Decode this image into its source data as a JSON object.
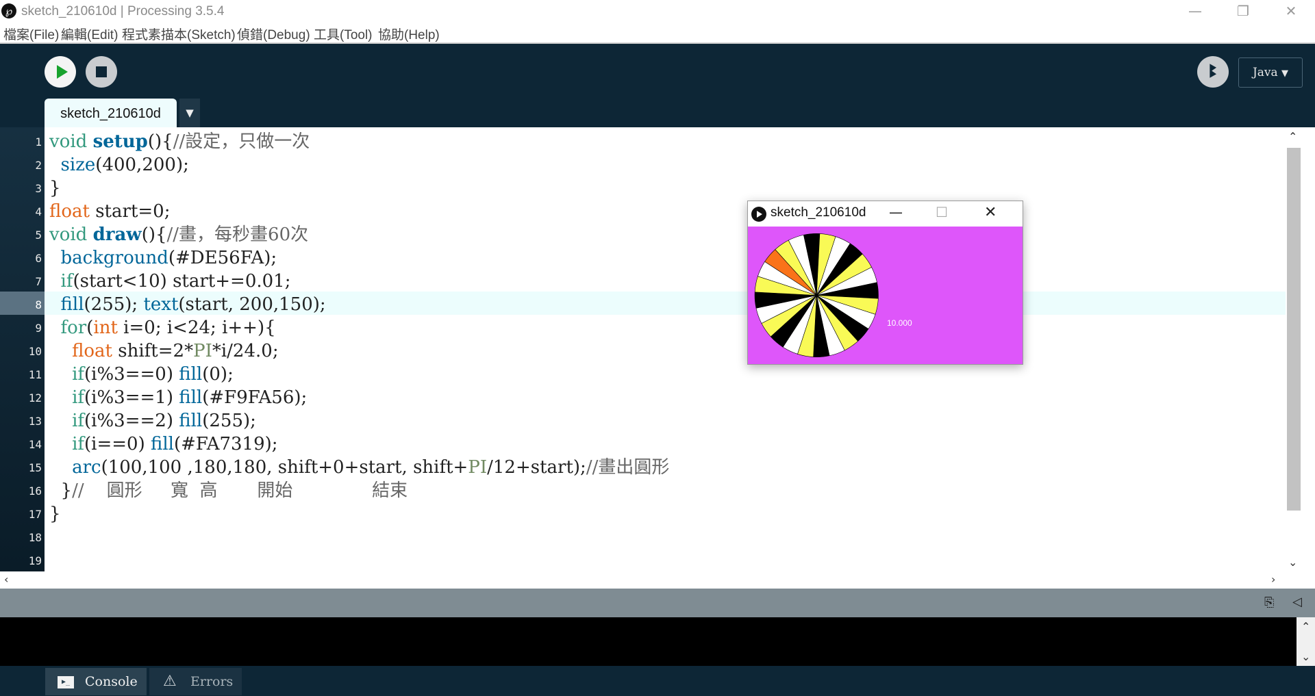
{
  "window": {
    "app_icon": "processing-p-icon",
    "title": "sketch_210610d | Processing 3.5.4",
    "controls": {
      "minimize": "—",
      "restore": "❐",
      "close": "✕"
    }
  },
  "menu": [
    "檔案(File)",
    "編輯(Edit)",
    "程式素描本(Sketch)",
    "偵錯(Debug)",
    "工具(Tool)",
    "協助(Help)"
  ],
  "toolbar": {
    "run_icon": "play-icon",
    "stop_icon": "stop-icon",
    "debug_icon": "butterfly-icon",
    "debug_glyph": "ꔪ",
    "mode": "Java",
    "mode_arrow": "▼"
  },
  "tabs": {
    "active": "sketch_210610d",
    "menu_arrow": "▼"
  },
  "editor": {
    "current_line": 8,
    "line_numbers": [
      "1",
      "2",
      "3",
      "4",
      "5",
      "6",
      "7",
      "8",
      "9",
      "10",
      "11",
      "12",
      "13",
      "14",
      "15",
      "16",
      "17",
      "18",
      "19"
    ],
    "lines": [
      [
        {
          "t": "void",
          "c": "k"
        },
        {
          "t": " "
        },
        {
          "t": "setup",
          "c": "fb"
        },
        {
          "t": "(){"
        },
        {
          "t": "//設定，只做一次",
          "c": "c"
        }
      ],
      [
        {
          "t": "  "
        },
        {
          "t": "size",
          "c": "f"
        },
        {
          "t": "(400,200);"
        }
      ],
      [
        {
          "t": "}"
        }
      ],
      [
        {
          "t": "float",
          "c": "t"
        },
        {
          "t": " start=0;"
        }
      ],
      [
        {
          "t": "void",
          "c": "k"
        },
        {
          "t": " "
        },
        {
          "t": "draw",
          "c": "fb"
        },
        {
          "t": "(){"
        },
        {
          "t": "//畫，每秒畫60次",
          "c": "c"
        }
      ],
      [
        {
          "t": "  "
        },
        {
          "t": "background",
          "c": "f"
        },
        {
          "t": "(#DE56FA);"
        }
      ],
      [
        {
          "t": "  "
        },
        {
          "t": "if",
          "c": "k"
        },
        {
          "t": "(start<10) start+=0.01;"
        }
      ],
      [
        {
          "t": "  "
        },
        {
          "t": "fill",
          "c": "f"
        },
        {
          "t": "(255); "
        },
        {
          "t": "text",
          "c": "f"
        },
        {
          "t": "(start, 200,150);"
        }
      ],
      [
        {
          "t": "  "
        },
        {
          "t": "for",
          "c": "k"
        },
        {
          "t": "("
        },
        {
          "t": "int",
          "c": "t"
        },
        {
          "t": " i=0; i<24; i++){"
        }
      ],
      [
        {
          "t": "    "
        },
        {
          "t": "float",
          "c": "t"
        },
        {
          "t": " shift=2*"
        },
        {
          "t": "PI",
          "c": "cn"
        },
        {
          "t": "*i/24.0;"
        }
      ],
      [
        {
          "t": "    "
        },
        {
          "t": "if",
          "c": "k"
        },
        {
          "t": "(i%3==0) "
        },
        {
          "t": "fill",
          "c": "f"
        },
        {
          "t": "(0);"
        }
      ],
      [
        {
          "t": "    "
        },
        {
          "t": "if",
          "c": "k"
        },
        {
          "t": "(i%3==1) "
        },
        {
          "t": "fill",
          "c": "f"
        },
        {
          "t": "(#F9FA56);"
        }
      ],
      [
        {
          "t": "    "
        },
        {
          "t": "if",
          "c": "k"
        },
        {
          "t": "(i%3==2) "
        },
        {
          "t": "fill",
          "c": "f"
        },
        {
          "t": "(255);"
        }
      ],
      [
        {
          "t": "    "
        },
        {
          "t": "if",
          "c": "k"
        },
        {
          "t": "(i==0) "
        },
        {
          "t": "fill",
          "c": "f"
        },
        {
          "t": "(#FA7319);"
        }
      ],
      [
        {
          "t": "    "
        },
        {
          "t": "arc",
          "c": "f"
        },
        {
          "t": "(100,100 ,180,180, shift+0+start, shift+"
        },
        {
          "t": "PI",
          "c": "cn"
        },
        {
          "t": "/12+start);"
        },
        {
          "t": "//畫出圓形",
          "c": "c"
        }
      ],
      [
        {
          "t": "  }"
        },
        {
          "t": "//    圓形     寬  高       開始              結束",
          "c": "c"
        }
      ],
      [
        {
          "t": "}"
        }
      ],
      [],
      []
    ]
  },
  "console_panel": {
    "copy_icon": "console-copy-icon",
    "collapse_icon": "collapse-left-icon",
    "tabs": [
      {
        "label": "Console",
        "icon": "terminal-icon",
        "glyph": "▶_"
      },
      {
        "label": "Errors",
        "icon": "warning-icon",
        "glyph": "⚠"
      }
    ]
  },
  "sketch_window": {
    "title": "sketch_210610d",
    "icon": "processing-run-icon",
    "controls": {
      "minimize": "—",
      "maximize": "☐",
      "close": "✕"
    },
    "start": 10.0,
    "counter_text": "10.000",
    "wheel": {
      "segments": 24,
      "colors": [
        "#000000",
        "#F9FA56",
        "#FFFFFF"
      ],
      "first_color": "#FA7319"
    },
    "background": "#DE56FA"
  }
}
